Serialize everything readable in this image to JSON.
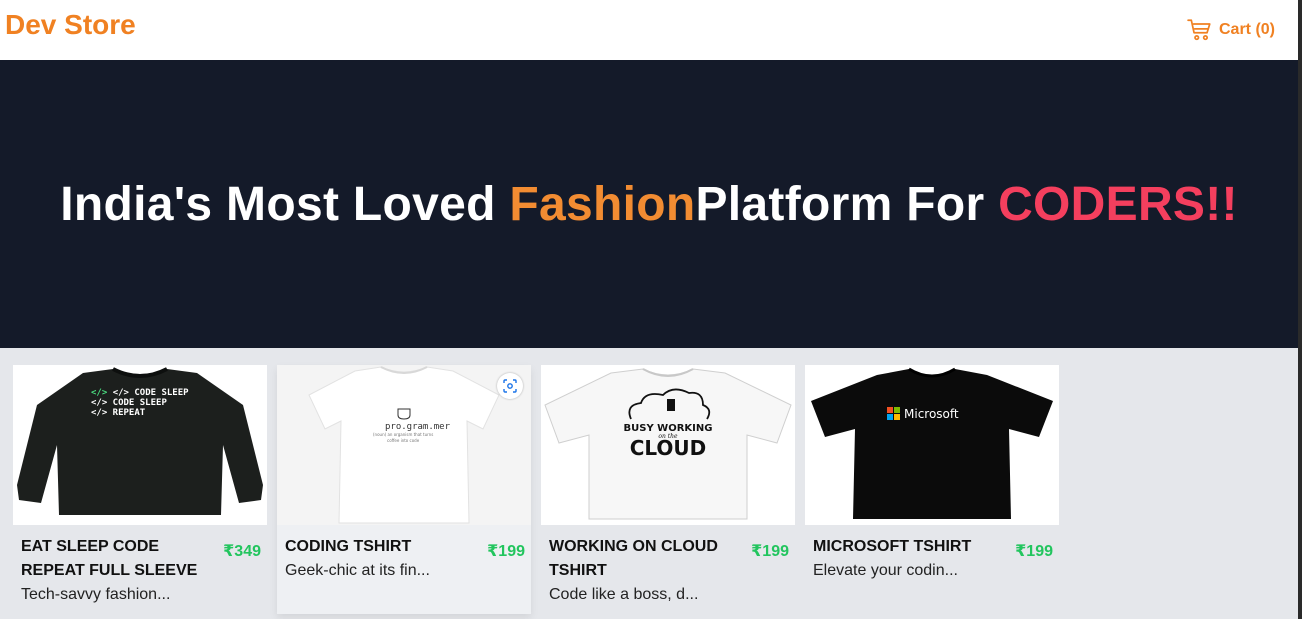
{
  "header": {
    "logo": "Dev Store",
    "cart_label": "Cart (0)"
  },
  "hero": {
    "part1": "India's Most Loved ",
    "part2": "Fashion",
    "part3": "Platform For ",
    "part4": "CODERS!!"
  },
  "products": [
    {
      "name": "EAT SLEEP CODE REPEAT FULL SLEEVE",
      "price": "₹349",
      "desc": "Tech-savvy fashion...",
      "image_icon": "black-sweatshirt-image",
      "image_lines": [
        "</> CODE SLEEP",
        "</> CODE SLEEP",
        "</> REPEAT"
      ]
    },
    {
      "name": "CODING TSHIRT",
      "price": "₹199",
      "desc": "Geek-chic at its fin...",
      "image_icon": "white-tshirt-image",
      "image_lines": [
        "pro.gram.mer",
        "(noun) an organism that turns",
        "coffee into code"
      ]
    },
    {
      "name": "WORKING ON CLOUD TSHIRT",
      "price": "₹199",
      "desc": "Code like a boss, d...",
      "image_icon": "white-tshirt-cloud-image",
      "image_lines": [
        "BUSY WORKING",
        "on the",
        "CLOUD"
      ]
    },
    {
      "name": "MICROSOFT TSHIRT",
      "price": "₹199",
      "desc": "Elevate your codin...",
      "image_icon": "black-tshirt-microsoft-image",
      "image_lines": [
        "Microsoft"
      ]
    }
  ],
  "colors": {
    "brand": "#f08122",
    "hero_bg": "#141a29",
    "accent_red": "#f43f5e",
    "price_green": "#22c55e"
  }
}
